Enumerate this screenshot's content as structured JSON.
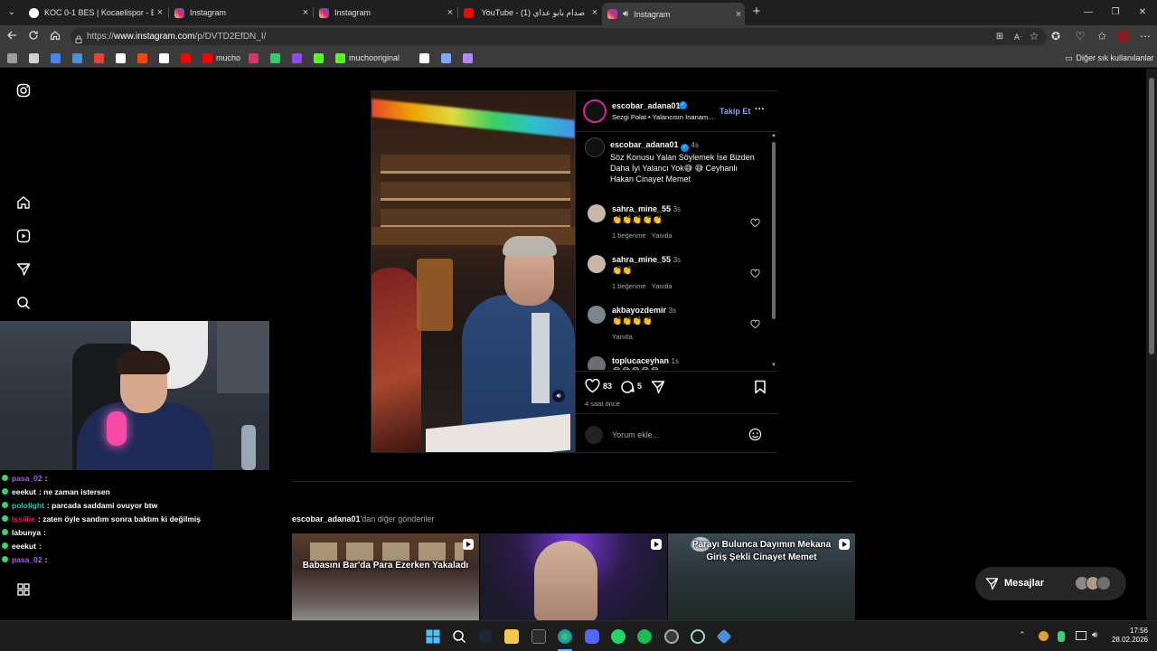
{
  "browser": {
    "tabs": [
      {
        "title": "KOC 0-1 BES | Kocaelispor - Beşiktaş",
        "close": "×",
        "favicon_color": "#ffffff"
      },
      {
        "title": "Instagram",
        "close": "×",
        "favicon_color": "#e1306c"
      },
      {
        "title": "Instagram",
        "close": "×",
        "favicon_color": "#e1306c"
      },
      {
        "title": "YouTube - صدام بابو عداي (1)",
        "close": "×",
        "favicon_color": "#ff0000"
      },
      {
        "title": "Instagram",
        "close": "×",
        "favicon_color": "#e1306c"
      }
    ],
    "new_tab": "+",
    "window_controls": {
      "minimize": "—",
      "maximize": "❐",
      "close": "✕"
    },
    "url": {
      "prefix": "https://",
      "host": "www.instagram.com",
      "path": "/p/DVTD2EfDN_I/"
    },
    "bookmarks": [
      {
        "label": "",
        "color": "#9e9e9e"
      },
      {
        "label": "",
        "color": "#d0d0d0"
      },
      {
        "label": "",
        "color": "#4285f4"
      },
      {
        "label": "",
        "color": "#4a90d9"
      },
      {
        "label": "",
        "color": "#ea4335"
      },
      {
        "label": "",
        "color": "#ffffff"
      },
      {
        "label": "",
        "color": "#ff4500"
      },
      {
        "label": "",
        "color": "#ffffff"
      },
      {
        "label": "",
        "color": "#ff0000"
      },
      {
        "label": "mucho",
        "color": "#ff0000"
      },
      {
        "label": "",
        "color": "#e1306c"
      },
      {
        "label": "",
        "color": "#25d366"
      },
      {
        "label": "",
        "color": "#9146ff"
      },
      {
        "label": "",
        "color": "#53fc18"
      },
      {
        "label": "muchooriginal",
        "color": "#53fc18"
      },
      {
        "label": "",
        "color": "#ffffff"
      },
      {
        "label": "",
        "color": "#7aa7ff"
      },
      {
        "label": "",
        "color": "#b388ff"
      }
    ],
    "other_bookmarks": "Diğer sık kullanılanlar"
  },
  "post": {
    "author": "escobar_adana01",
    "audio": "Sezgi Polat • Yalancısın İnanam...",
    "follow": "Takip Et",
    "more": "···",
    "caption": {
      "author": "escobar_adana01",
      "time": "4s",
      "text": "Söz Konusu Yalan Söylemek İse Bizden Daha İyi Yalancı Yok😅 😅 Ceyhanlı Hakan Cinayet Memet"
    },
    "comments": [
      {
        "user": "sahra_mine_55",
        "time": "3s",
        "text": "👏👏👏👏👏",
        "likes": "1 beğenme",
        "reply": "Yanıtla"
      },
      {
        "user": "sahra_mine_55",
        "time": "3s",
        "text": "👏👏",
        "likes": "1 beğenme",
        "reply": "Yanıtla"
      },
      {
        "user": "akbayozdemir",
        "time": "3s",
        "text": "👏👏👏👏",
        "likes": "",
        "reply": "Yanıtla"
      },
      {
        "user": "toplucaceyhan",
        "time": "1s",
        "text": "😂😂😂😂😂",
        "likes": "",
        "reply": ""
      }
    ],
    "like_count": "83",
    "comment_count": "5",
    "posted_ago": "4 saat önce",
    "comment_placeholder": "Yorum ekle..."
  },
  "more_posts": {
    "heading_user": "escobar_adana01",
    "heading_suffix": "'dan diğer gönderiler",
    "thumbs": [
      {
        "caption": "Babasını Bar'da Para Ezerken Yakaladı"
      },
      {
        "caption": ""
      },
      {
        "caption": "Parayı Bulunca Dayımın Mekana Giriş Şekli Cinayet Memet"
      }
    ]
  },
  "messages_button": "Mesajlar",
  "stream_chat": [
    {
      "user": "pasa_02",
      "msg": ":",
      "user_color": "#b05cf5"
    },
    {
      "user": "eeekut",
      "msg": ": ne zaman istersen",
      "user_color": "#ffffff"
    },
    {
      "user": "pololight",
      "msg": ": parcada saddami ovuyor btw",
      "user_color": "#2ec4b6"
    },
    {
      "user": "lssillie",
      "msg": ": zaten öyle sandım sonra baktım ki değilmiş",
      "user_color": "#e0245e"
    },
    {
      "user": "labunya",
      "msg": ":",
      "user_color": "#ffffff"
    },
    {
      "user": "eeekut",
      "msg": ":",
      "user_color": "#ffffff"
    },
    {
      "user": "pasa_02",
      "msg": ":",
      "user_color": "#b05cf5"
    }
  ],
  "taskbar": {
    "time": "17:56",
    "date": "28.02.2026"
  }
}
